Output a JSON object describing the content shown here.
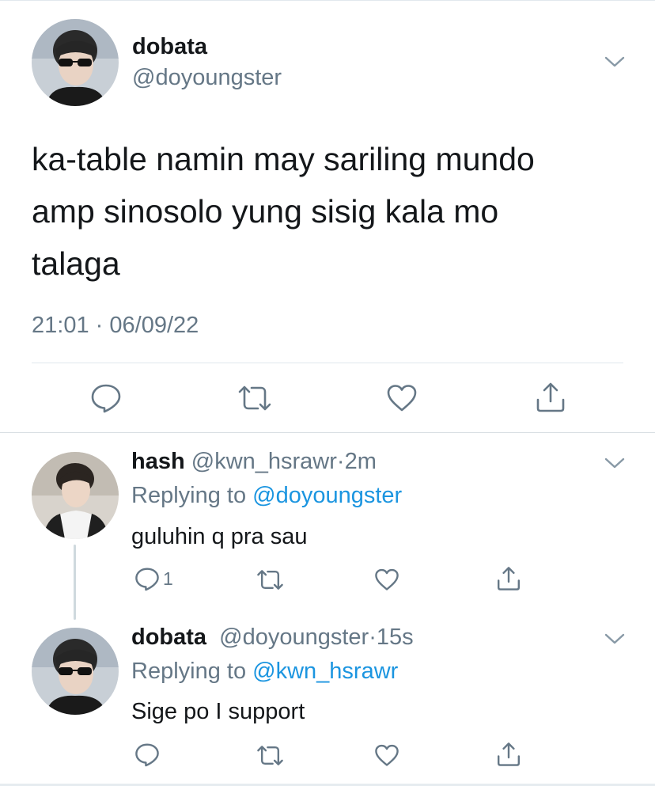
{
  "main_tweet": {
    "display_name": "dobata",
    "handle": "@doyoungster",
    "text_lines": [
      "ka-table namin may sariling mundo",
      "amp sinosolo yung sisig kala mo",
      "talaga"
    ],
    "time": "21:01",
    "separator": "·",
    "date": "06/09/22",
    "actions": {
      "reply_icon": "reply-bubble-icon",
      "retweet_icon": "retweet-icon",
      "like_icon": "heart-icon",
      "share_icon": "share-icon"
    }
  },
  "replies": [
    {
      "display_name": "hash",
      "handle": "@kwn_hsrawr",
      "separator": "·",
      "age": "2m",
      "replying_prefix": "Replying to",
      "replying_to": "@doyoungster",
      "text": "guluhin q pra sau",
      "reply_count": "1"
    },
    {
      "display_name": "dobata",
      "handle": "@doyoungster",
      "separator": "·",
      "age": "15s",
      "replying_prefix": "Replying to",
      "replying_to": "@kwn_hsrawr",
      "text": "Sige po I support",
      "reply_count": ""
    }
  ],
  "colors": {
    "text": "#14171a",
    "secondary": "#657786",
    "link": "#1b95e0",
    "divider": "#e1e8ed"
  }
}
